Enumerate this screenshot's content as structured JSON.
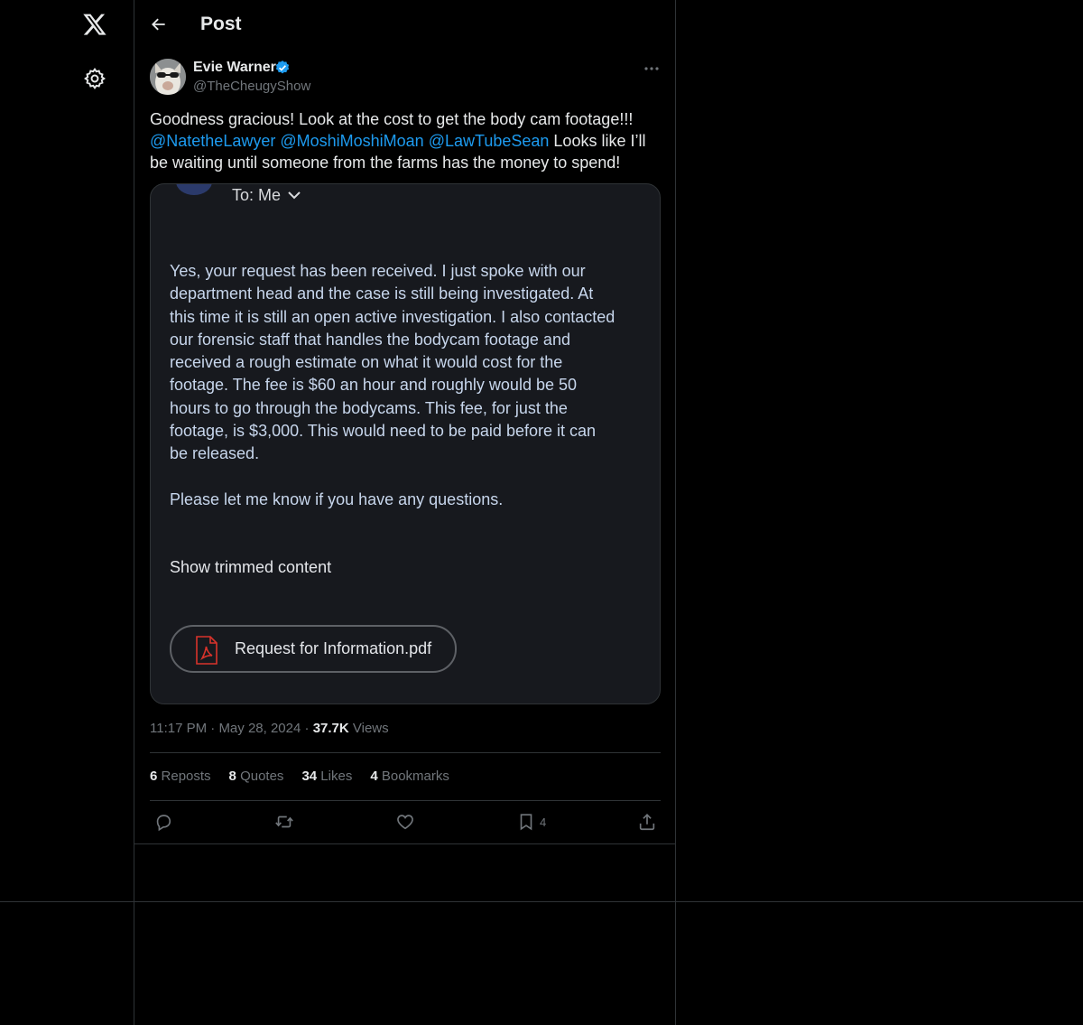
{
  "header": {
    "title": "Post"
  },
  "author": {
    "name": "Evie Warner",
    "handle": "@TheCheugyShow",
    "verified": true
  },
  "tweet": {
    "text_intro": "Goodness gracious! Look at the cost to get the body cam footage!!!",
    "mentions": [
      "@NatetheLawyer",
      "@MoshiMoshiMoan",
      "@LawTubeSean"
    ],
    "text_outro": "Looks like I’ll be waiting until someone from the farms has the money to spend!"
  },
  "media": {
    "to_line": "To: Me",
    "email_body": "Yes, your request has been received.  I just spoke with our\ndepartment head and the case is still being investigated.  At\nthis time it is still an open active investigation.  I also contacted\nour forensic staff that handles the bodycam footage and\nreceived a rough estimate on what it would cost for the\nfootage.  The fee is $60 an hour and roughly would be 50\nhours to go through the bodycams.  This fee, for just the\nfootage, is $3,000.   This would need to be paid before it can\nbe released.",
    "closing": "Please let me know if you have any questions.",
    "trimmed_label": "Show trimmed content",
    "attachment_name": "Request for Information.pdf"
  },
  "meta": {
    "time": "11:17 PM",
    "date": "May 28, 2024",
    "views_count": "37.7K",
    "views_label": "Views"
  },
  "stats": {
    "reposts_count": "6",
    "reposts_label": "Reposts",
    "quotes_count": "8",
    "quotes_label": "Quotes",
    "likes_count": "34",
    "likes_label": "Likes",
    "bookmarks_count": "4",
    "bookmarks_label": "Bookmarks"
  },
  "actions": {
    "bookmark_count": "4"
  },
  "icons": {
    "logo": "x-logo-icon",
    "settings": "gear-icon",
    "back": "arrow-left-icon",
    "verified": "verified-badge-icon",
    "more": "more-horizontal-icon",
    "reply": "reply-icon",
    "repost": "repost-icon",
    "like": "heart-icon",
    "bookmark": "bookmark-icon",
    "share": "share-icon",
    "pdf": "pdf-icon"
  },
  "colors": {
    "background": "#000000",
    "accent": "#1d9bf0",
    "muted": "#71767b",
    "border": "#2f3336"
  }
}
